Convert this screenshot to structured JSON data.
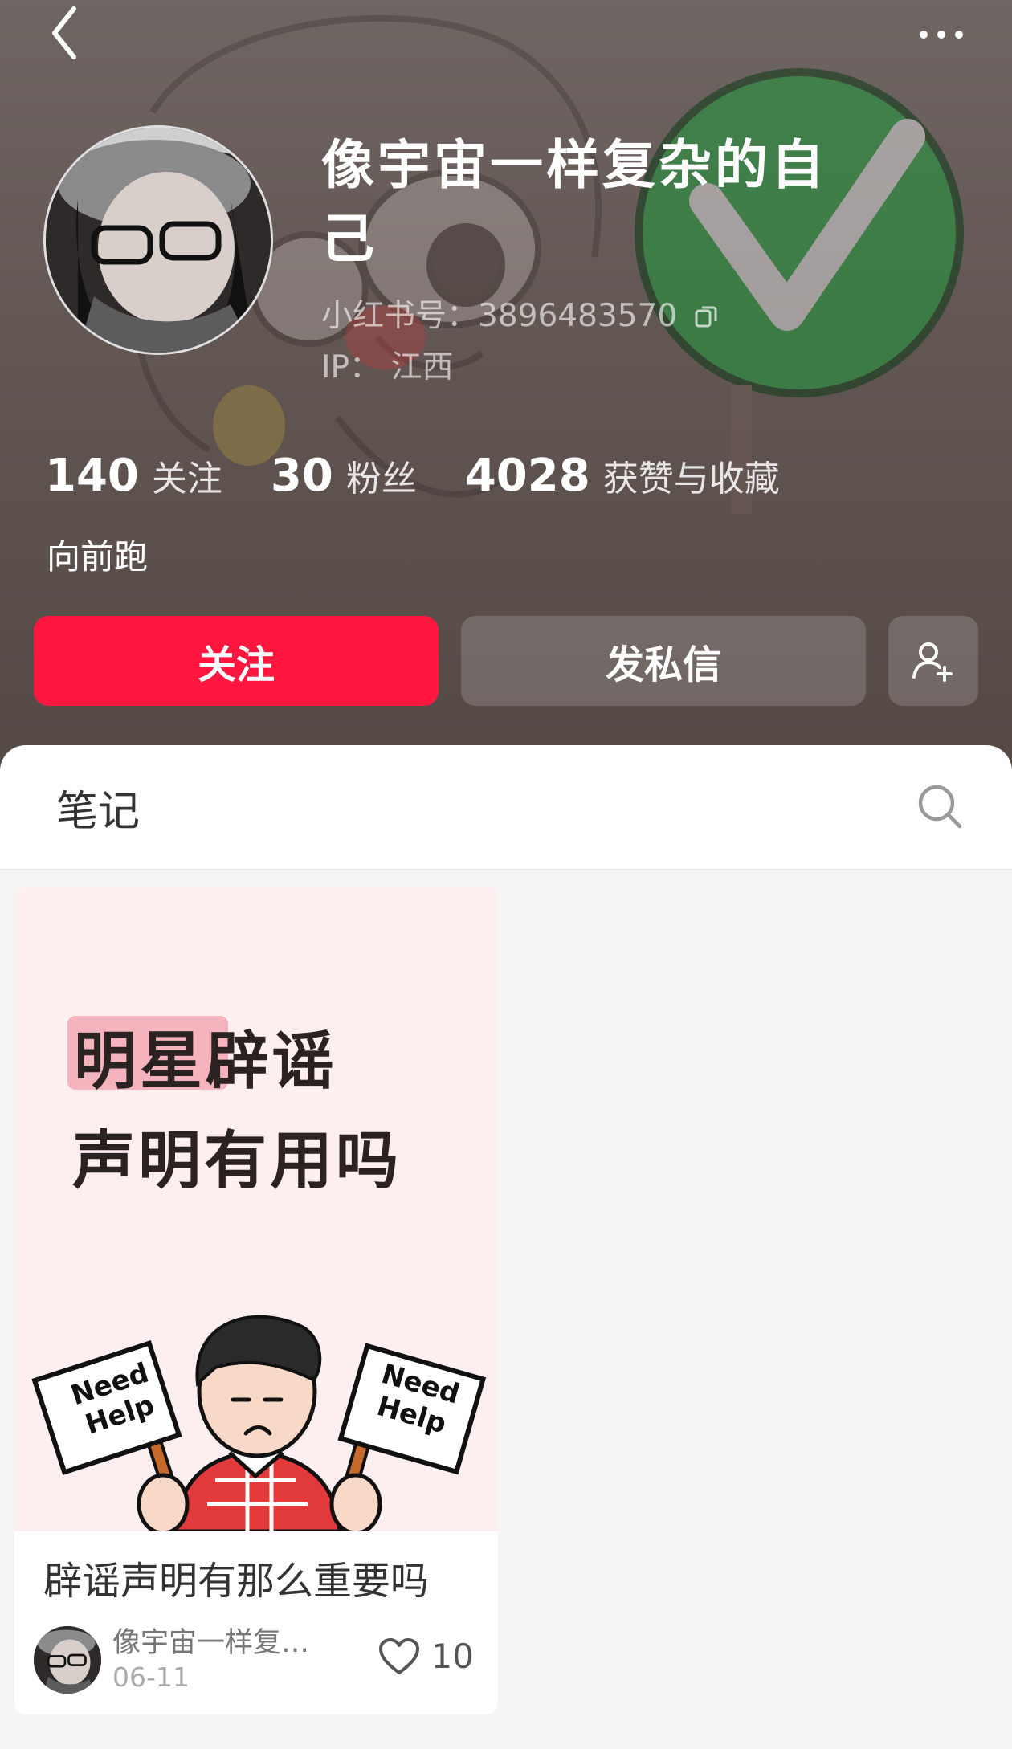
{
  "topbar": {
    "back_icon": "chevron-left-icon",
    "more_icon": "more-horizontal-icon"
  },
  "profile": {
    "nickname": "像宇宙一样复杂的自己",
    "red_id_label": "小红书号：",
    "red_id_value": "3896483570",
    "ip_label": "IP：",
    "ip_value": "江西",
    "bio": "向前跑"
  },
  "stats": [
    {
      "value": "140",
      "label": "关注"
    },
    {
      "value": "30",
      "label": "粉丝"
    },
    {
      "value": "4028",
      "label": "获赞与收藏"
    }
  ],
  "actions": {
    "follow_label": "关注",
    "message_label": "发私信",
    "add_friend_icon": "add-user-icon"
  },
  "tabs": {
    "notes_label": "笔记",
    "search_icon": "search-icon"
  },
  "note": {
    "cover_line1": "明星辟谣",
    "cover_line2": "声明有用吗",
    "sign_text_1": "Need Help",
    "sign_text_2": "Need Help",
    "title": "辟谣声明有那么重要吗",
    "author": "像宇宙一样复…",
    "date": "06-11",
    "likes": "10"
  },
  "colors": {
    "primary": "#ff1740",
    "header_bg": "#625653",
    "cover_bg": "#fdeef0"
  }
}
